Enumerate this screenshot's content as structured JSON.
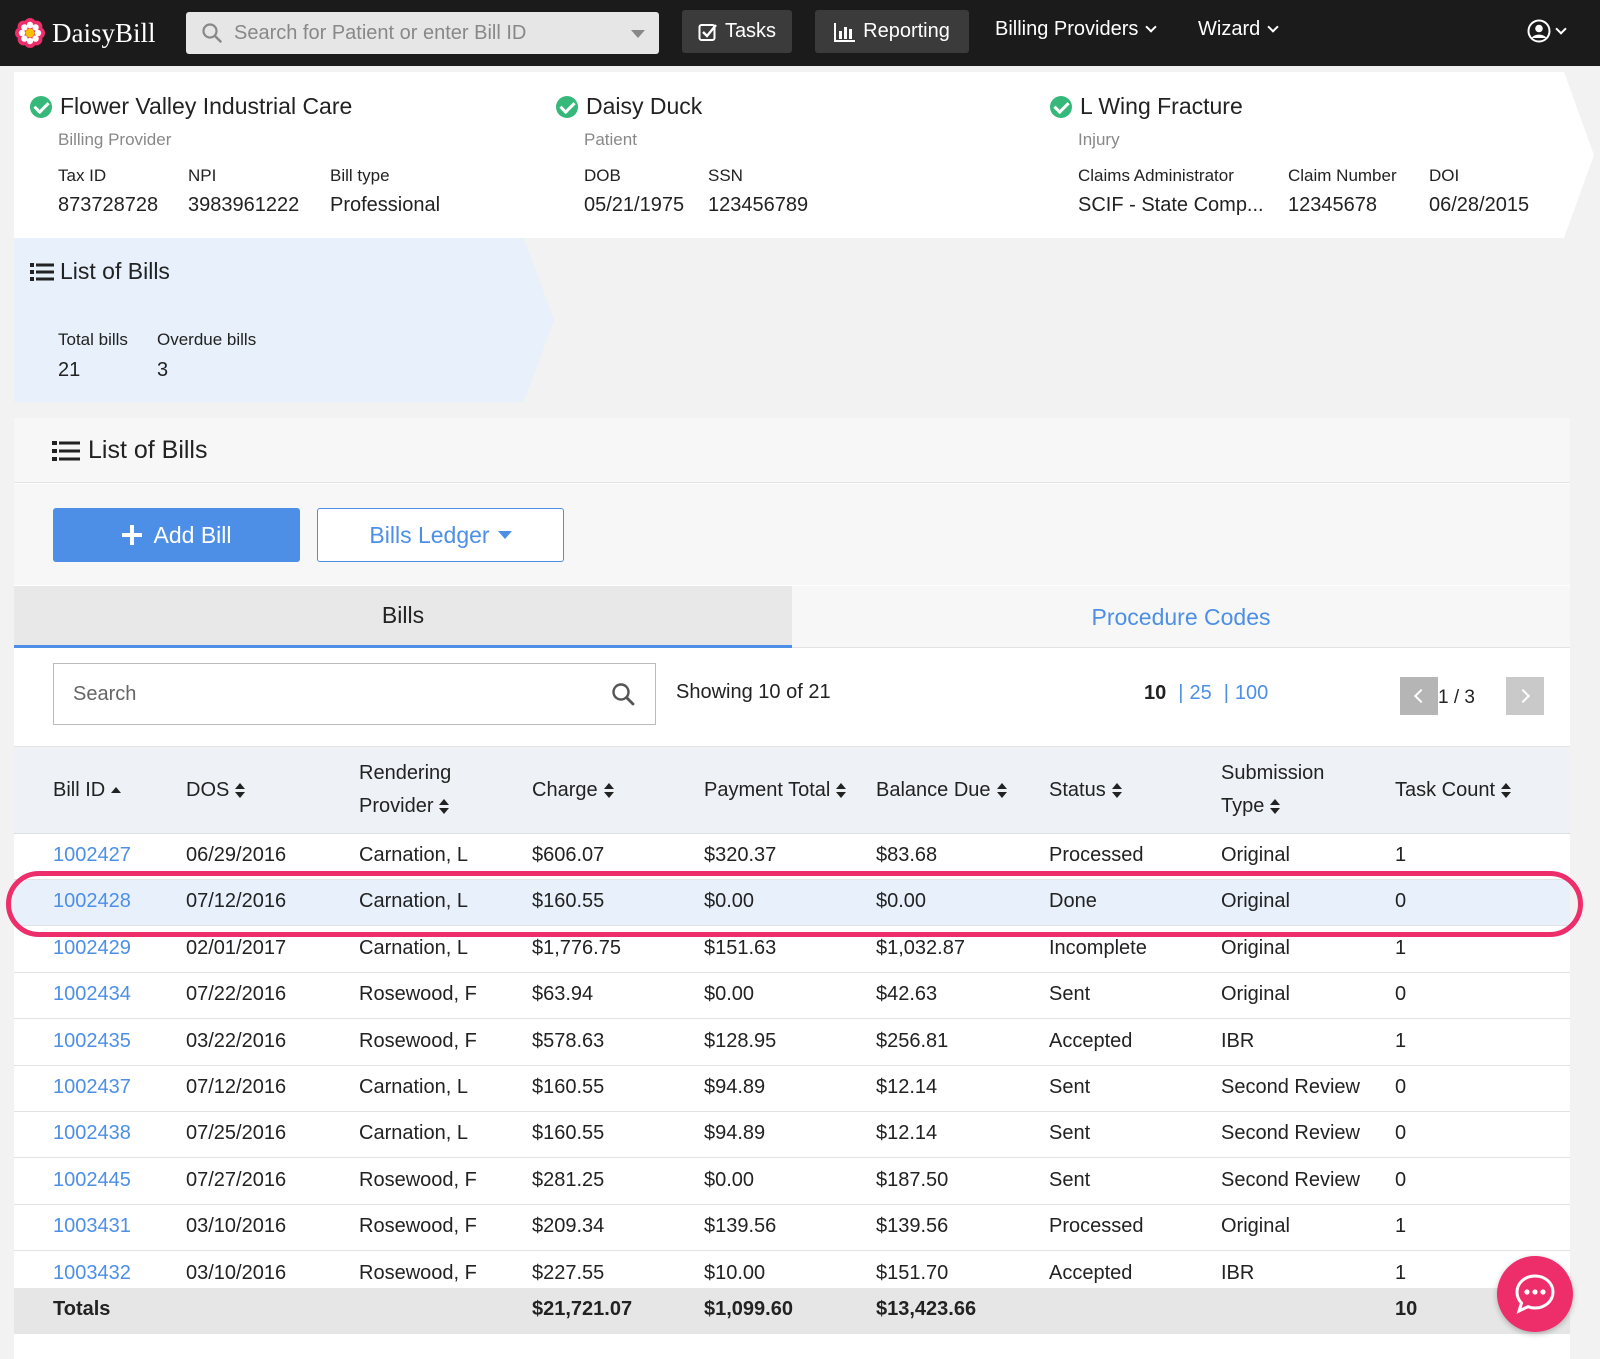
{
  "nav": {
    "logo_text": "DaisyBill",
    "search_placeholder": "Search for Patient or enter Bill ID",
    "tasks_label": "Tasks",
    "reporting_label": "Reporting",
    "billing_providers_label": "Billing Providers",
    "wizard_label": "Wizard"
  },
  "breadcrumbs": {
    "provider": {
      "title": "Flower Valley Industrial Care",
      "subtitle": "Billing Provider",
      "fields": [
        {
          "label": "Tax ID",
          "value": "873728728"
        },
        {
          "label": "NPI",
          "value": "3983961222"
        },
        {
          "label": "Bill type",
          "value": "Professional"
        }
      ]
    },
    "patient": {
      "title": "Daisy Duck",
      "subtitle": "Patient",
      "fields": [
        {
          "label": "DOB",
          "value": "05/21/1975"
        },
        {
          "label": "SSN",
          "value": "123456789"
        }
      ]
    },
    "injury": {
      "title": "L Wing Fracture",
      "subtitle": "Injury",
      "fields": [
        {
          "label": "Claims Administrator",
          "value": "SCIF - State Comp..."
        },
        {
          "label": "Claim Number",
          "value": "12345678"
        },
        {
          "label": "DOI",
          "value": "06/28/2015"
        }
      ]
    },
    "bills": {
      "title": "List of Bills",
      "fields": [
        {
          "label": "Total bills",
          "value": "21"
        },
        {
          "label": "Overdue bills",
          "value": "3"
        }
      ]
    }
  },
  "panel": {
    "title": "List of Bills",
    "add_bill_label": "Add Bill",
    "bills_ledger_label": "Bills Ledger",
    "tabs": [
      {
        "label": "Bills",
        "active": true
      },
      {
        "label": "Procedure Codes",
        "active": false
      }
    ],
    "search_placeholder": "Search",
    "showing_text": "Showing 10 of 21",
    "page_sizes": [
      "10",
      "25",
      "100"
    ],
    "page_indicator": "1 / 3"
  },
  "table": {
    "headers": [
      {
        "line1": "Bill ID",
        "line2": ""
      },
      {
        "line1": "DOS",
        "line2": ""
      },
      {
        "line1": "Rendering",
        "line2": "Provider"
      },
      {
        "line1": "Charge",
        "line2": ""
      },
      {
        "line1": "Payment Total",
        "line2": ""
      },
      {
        "line1": "Balance Due",
        "line2": ""
      },
      {
        "line1": "Status",
        "line2": ""
      },
      {
        "line1": "Submission",
        "line2": "Type"
      },
      {
        "line1": "Task Count",
        "line2": ""
      }
    ],
    "rows": [
      {
        "bill_id": "1002427",
        "dos": "06/29/2016",
        "provider": "Carnation, L",
        "charge": "$606.07",
        "payment": "$320.37",
        "balance": "$83.68",
        "status": "Processed",
        "submission": "Original",
        "tasks": "1"
      },
      {
        "bill_id": "1002428",
        "dos": "07/12/2016",
        "provider": "Carnation, L",
        "charge": "$160.55",
        "payment": "$0.00",
        "balance": "$0.00",
        "status": "Done",
        "submission": "Original",
        "tasks": "0"
      },
      {
        "bill_id": "1002429",
        "dos": "02/01/2017",
        "provider": "Carnation, L",
        "charge": "$1,776.75",
        "payment": "$151.63",
        "balance": "$1,032.87",
        "status": "Incomplete",
        "submission": "Original",
        "tasks": "1"
      },
      {
        "bill_id": "1002434",
        "dos": "07/22/2016",
        "provider": "Rosewood, F",
        "charge": "$63.94",
        "payment": "$0.00",
        "balance": "$42.63",
        "status": "Sent",
        "submission": "Original",
        "tasks": "0"
      },
      {
        "bill_id": "1002435",
        "dos": "03/22/2016",
        "provider": "Rosewood, F",
        "charge": "$578.63",
        "payment": "$128.95",
        "balance": "$256.81",
        "status": "Accepted",
        "submission": "IBR",
        "tasks": "1"
      },
      {
        "bill_id": "1002437",
        "dos": "07/12/2016",
        "provider": "Carnation, L",
        "charge": "$160.55",
        "payment": "$94.89",
        "balance": "$12.14",
        "status": "Sent",
        "submission": "Second Review",
        "tasks": "0"
      },
      {
        "bill_id": "1002438",
        "dos": "07/25/2016",
        "provider": "Carnation, L",
        "charge": "$160.55",
        "payment": "$94.89",
        "balance": "$12.14",
        "status": "Sent",
        "submission": "Second Review",
        "tasks": "0"
      },
      {
        "bill_id": "1002445",
        "dos": "07/27/2016",
        "provider": "Rosewood, F",
        "charge": "$281.25",
        "payment": "$0.00",
        "balance": "$187.50",
        "status": "Sent",
        "submission": "Second Review",
        "tasks": "0"
      },
      {
        "bill_id": "1003431",
        "dos": "03/10/2016",
        "provider": "Rosewood, F",
        "charge": "$209.34",
        "payment": "$139.56",
        "balance": "$139.56",
        "status": "Processed",
        "submission": "Original",
        "tasks": "1"
      },
      {
        "bill_id": "1003432",
        "dos": "03/10/2016",
        "provider": "Rosewood, F",
        "charge": "$227.55",
        "payment": "$10.00",
        "balance": "$151.70",
        "status": "Accepted",
        "submission": "IBR",
        "tasks": "1"
      }
    ],
    "totals": {
      "label": "Totals",
      "charge": "$21,721.07",
      "payment": "$1,099.60",
      "balance": "$13,423.66",
      "tasks": "10"
    }
  },
  "colors": {
    "accent": "#4d8fe6",
    "success": "#35b87a",
    "highlight": "#ee2d6b",
    "nav_bg": "#1b1b1b"
  },
  "icons": [
    "daisy-logo-icon",
    "search-icon",
    "tasks-check-icon",
    "reporting-chart-icon",
    "user-account-icon",
    "list-icon",
    "plus-icon",
    "chat-icon"
  ]
}
